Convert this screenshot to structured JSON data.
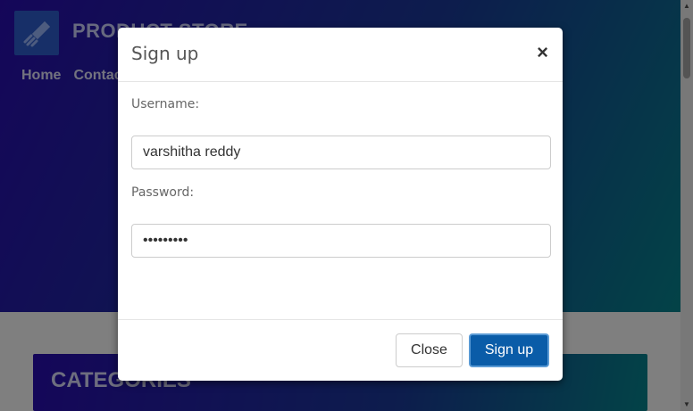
{
  "header": {
    "brand": "PRODUCT STORE",
    "nav": [
      "Home",
      "Contact"
    ]
  },
  "categories_title": "CATEGORIES",
  "modal": {
    "title": "Sign up",
    "close_symbol": "×",
    "username_label": "Username:",
    "username_value": "varshitha reddy",
    "password_label": "Password:",
    "password_value": "•••••••••",
    "close_button": "Close",
    "signup_button": "Sign up"
  },
  "colors": {
    "hero_start": "#2a0db3",
    "hero_end": "#06868f",
    "primary_button": "#0a5ca8"
  },
  "icons": {
    "logo": "rocket-icon",
    "close": "close-icon"
  }
}
